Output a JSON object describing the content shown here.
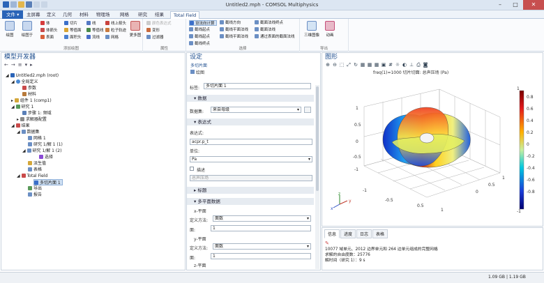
{
  "window": {
    "title": "Untitled2.mph - COMSOL Multiphysics"
  },
  "tabs": [
    {
      "label": "文件 ▾"
    },
    {
      "label": "主屏幕"
    },
    {
      "label": "定义"
    },
    {
      "label": "几何"
    },
    {
      "label": "材料"
    },
    {
      "label": "物理场"
    },
    {
      "label": "网格"
    },
    {
      "label": "研究"
    },
    {
      "label": "结果"
    },
    {
      "label": "Total Field"
    }
  ],
  "ribbon": {
    "plot": "绘图",
    "plot_in": "绘图于",
    "group_add": "添加绘图",
    "items_a": [
      "体",
      "体箭头",
      "表面"
    ],
    "items_b": [
      "切片",
      "等值面",
      "面积头"
    ],
    "items_c": [
      "线",
      "等值线",
      "流线"
    ],
    "items_d": [
      "线上箭头",
      "粒子轨迹",
      "网格"
    ],
    "more": "更多图",
    "attr_a": "颜色表达式",
    "attr_b": "变形",
    "attr_c": "过滤器",
    "group_attr": "属性",
    "sel_a": [
      "设法向计算",
      "截线起点",
      "截线起点",
      "截线终点"
    ],
    "sel_b": [
      "截线方向",
      "截线平面法线",
      "截线平面法线"
    ],
    "sel_c": [
      "截面法线终点",
      "截面法线",
      "通过表面的截面法线"
    ],
    "group_sel": "选择",
    "export_a": "三维图像",
    "export_b": "动画",
    "group_export": "导出"
  },
  "model_builder": {
    "title": "模型开发器",
    "tree": [
      "Untitled2.mph (root)",
      "全局定义",
      "参数",
      "材料",
      "组件 1 (comp1)",
      "研究 1",
      "步骤 1: 频域",
      "求解器配置",
      "结果",
      "数据集",
      "网格 1",
      "研究 1/解 1 (1)",
      "研究 1/解 1 (2)",
      "选择",
      "派生值",
      "表格",
      "Total Field",
      "多切片面 1",
      "导出",
      "报告"
    ]
  },
  "settings": {
    "title": "设定",
    "subtitle": "多切片面",
    "plot_label": "绘图",
    "label_caption": "标签:",
    "label_value": "多切片面 1",
    "data_section": "数据",
    "dataset_caption": "数据集:",
    "dataset_value": "来自母级",
    "expr_section": "表达式",
    "expr_caption": "表达式:",
    "expr_value": "acpr.p_t",
    "unit_caption": "单位:",
    "unit_value": "Pa",
    "desc_caption": "描述",
    "desc_value": "总声压场",
    "title_section": "标题",
    "multi_section": "多平面数据",
    "x_plane": "x-平面",
    "y_plane": "y-平面",
    "z_plane": "z-平面",
    "method_caption": "定义方法:",
    "method_value": "面数",
    "planes_caption": "面:",
    "planes_value": "1"
  },
  "graphics": {
    "title": "图形",
    "plot_title": "freq(1)=1000  切片切面: 总声压场 (Pa)",
    "colorbar": {
      "max": "1",
      "min": "-1",
      "ticks": [
        "0.8",
        "0.6",
        "0.4",
        "0.2",
        "0",
        "-0.2",
        "-0.4",
        "-0.6",
        "-0.8"
      ]
    },
    "axis_ticks": [
      "1",
      "0.5",
      "0",
      "-0.5",
      "-1"
    ],
    "axis_names": [
      "z",
      "y",
      "x"
    ]
  },
  "bottom": {
    "tabs": [
      "信息",
      "进度",
      "日志",
      "表格"
    ],
    "lines": [
      "10077 域单元、2012 边界单元和 264 边单元组成的完整网格",
      "求解的自由度数：25776",
      "解时间（研究 1）：9 s"
    ]
  },
  "status": {
    "memory": "1.09 GB | 1.19 GB"
  }
}
